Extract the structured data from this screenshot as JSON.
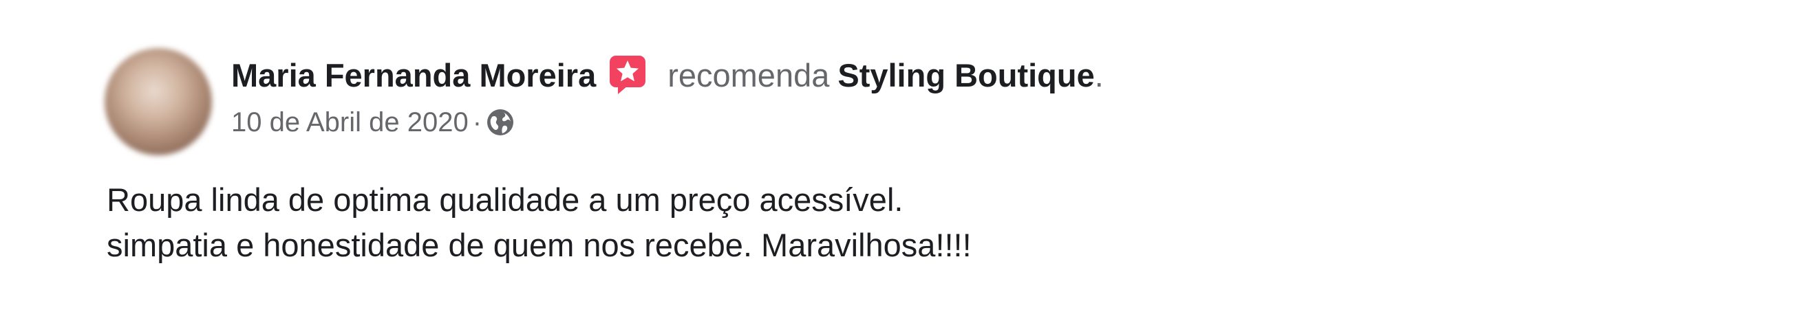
{
  "post": {
    "author": "Maria Fernanda Moreira",
    "recommend_icon": "recommendation-star-icon",
    "recommend_word": "recomenda",
    "page_name": "Styling Boutique",
    "period": ".",
    "date": "10 de Abril de 2020",
    "separator": "·",
    "privacy_icon": "globe-icon",
    "text_lines": [
      "Roupa linda de optima qualidade a um preço acessível.",
      "simpatia e honestidade de quem nos recebe. Maravilhosa!!!!"
    ]
  },
  "colors": {
    "primary_text": "#1c1e21",
    "secondary_text": "#65676b",
    "recommend_icon": "#f3425f"
  }
}
